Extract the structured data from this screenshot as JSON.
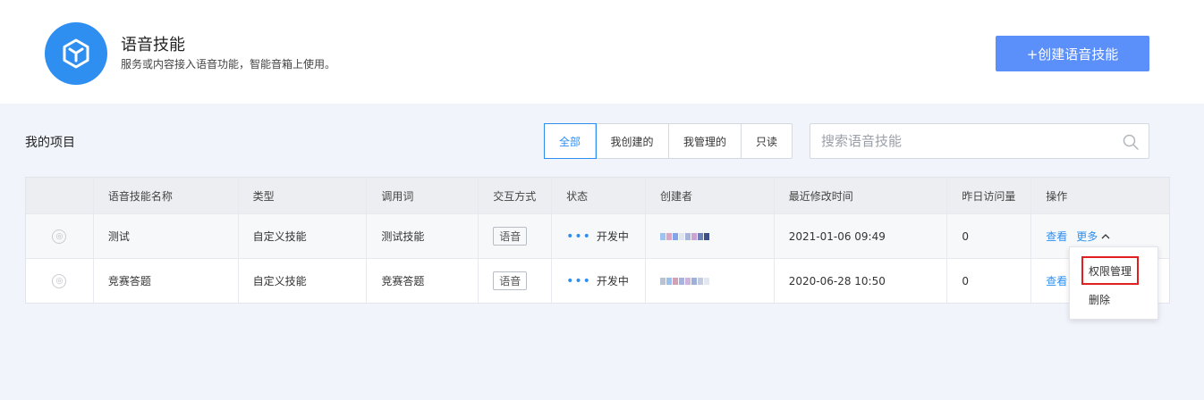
{
  "header": {
    "logo_icon": "cube-icon",
    "title": "语音技能",
    "description": "服务或内容接入语音功能，智能音箱上使用。",
    "create_button": "+创建语音技能"
  },
  "section": {
    "title": "我的项目"
  },
  "filters": [
    "全部",
    "我创建的",
    "我管理的",
    "只读"
  ],
  "active_filter": "全部",
  "search": {
    "placeholder": "搜索语音技能",
    "value": ""
  },
  "table": {
    "columns": [
      "",
      "语音技能名称",
      "类型",
      "调用词",
      "交互方式",
      "状态",
      "创建者",
      "最近修改时间",
      "昨日访问量",
      "操作"
    ],
    "rows": [
      {
        "name": "测试",
        "type": "自定义技能",
        "invocation": "测试技能",
        "interaction": "语音",
        "status": "开发中",
        "modified": "2021-01-06 09:49",
        "visits": "0",
        "view": "查看",
        "more": "更多"
      },
      {
        "name": "竞赛答题",
        "type": "自定义技能",
        "invocation": "竞赛答题",
        "interaction": "语音",
        "status": "开发中",
        "modified": "2020-06-28 10:50",
        "visits": "0",
        "view": "查看",
        "more": ""
      }
    ]
  },
  "dropdown": {
    "items": [
      "权限管理",
      "删除"
    ],
    "highlighted": "权限管理"
  },
  "colors": {
    "accent": "#2e8ff0",
    "button": "#5b8ff9",
    "highlight": "#e02020"
  }
}
